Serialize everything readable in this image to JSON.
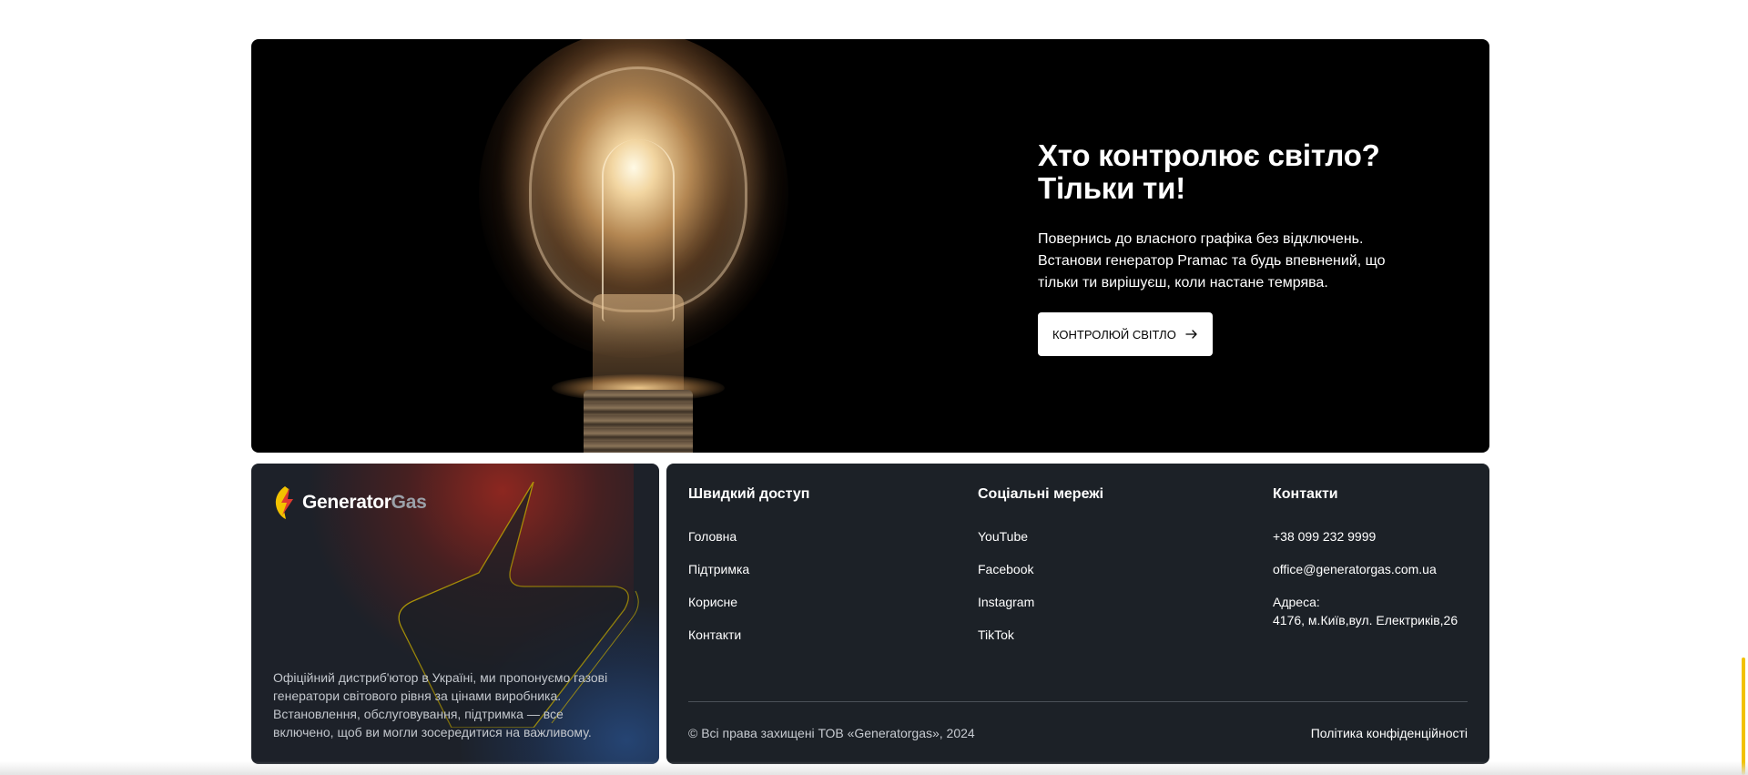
{
  "hero": {
    "title_line1": "Хто контролює світло?",
    "title_line2": "Тільки ти!",
    "text_line1": "Повернись до власного графіка без відключень.",
    "text_line2": "Встанови генератор Pramac та будь впевнений, що",
    "text_line3": "тільки ти вирішуєш, коли настане темрява.",
    "cta_label": "КОНТРОЛЮЙ СВІТЛО",
    "cta_icon": "arrow-right-icon"
  },
  "brand": {
    "logo_part1": "Generator",
    "logo_part2": "Gas",
    "logo_icon": "lightning-bolt-icon",
    "desc_line1": "Офіційний дистриб'ютор в Україні, ми пропонуємо газові",
    "desc_line2": "генератори світового рівня за цінами виробника.",
    "desc_line3": "Встановлення, обслуговування, підтримка — все",
    "desc_line4": "включено, щоб ви могли зосередитися на важливому.",
    "accent_color": "#f2c200"
  },
  "footer": {
    "quick_access": {
      "title": "Швидкий доступ",
      "items": [
        "Головна",
        "Підтримка",
        "Корисне",
        "Контакти"
      ]
    },
    "social": {
      "title": "Соціальні мережі",
      "items": [
        "YouTube",
        "Facebook",
        "Instagram",
        "TikTok"
      ]
    },
    "contacts": {
      "title": "Контакти",
      "phone": "+38 099 232 9999",
      "email": "office@generatorgas.com.ua",
      "address_label": "Адреса:",
      "address": "4176, м.Київ,вул. Електриків,26"
    },
    "copyright": "© Всі права захищені ТОВ «Generatorgas», 2024",
    "privacy": "Політика конфіденційності"
  }
}
